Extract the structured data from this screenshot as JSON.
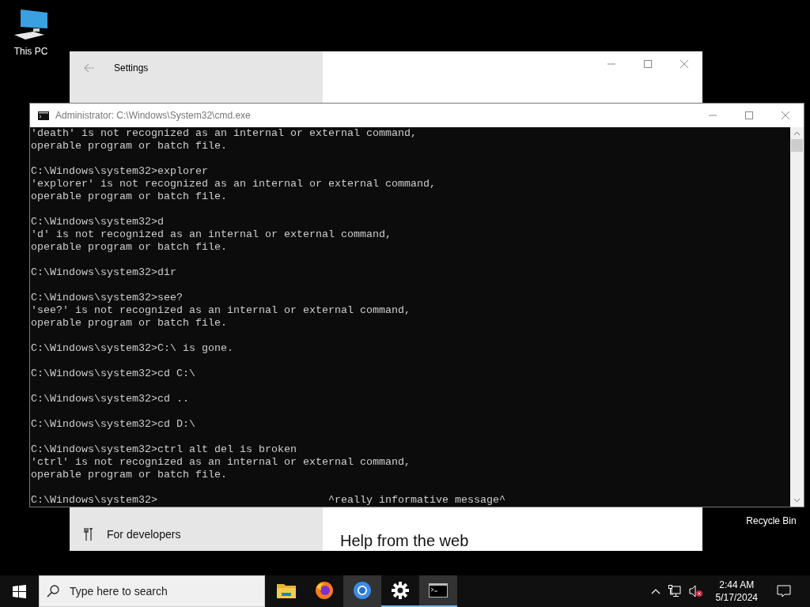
{
  "desktop_icons": [
    {
      "kind": "computer",
      "label": "This PC"
    },
    {
      "kind": "recycle",
      "label": "Recycle Bin"
    }
  ],
  "settings_window": {
    "title": "Settings",
    "sidebar_item": "For developers",
    "heading": "Help from the web"
  },
  "cmd_window": {
    "title": "Administrator: C:\\Windows\\System32\\cmd.exe",
    "blocks": [
      {
        "lines": [
          "'death' is not recognized as an internal or external command,",
          "operable program or batch file."
        ]
      },
      {
        "lines": [
          "C:\\Windows\\system32>explorer",
          "'explorer' is not recognized as an internal or external command,",
          "operable program or batch file."
        ]
      },
      {
        "lines": [
          "C:\\Windows\\system32>d",
          "'d' is not recognized as an internal or external command,",
          "operable program or batch file."
        ]
      },
      {
        "lines": [
          "C:\\Windows\\system32>dir"
        ]
      },
      {
        "lines": [
          "C:\\Windows\\system32>see?",
          "'see?' is not recognized as an internal or external command,",
          "operable program or batch file."
        ]
      },
      {
        "lines": [
          "C:\\Windows\\system32>C:\\ is gone."
        ]
      },
      {
        "lines": [
          "C:\\Windows\\system32>cd C:\\"
        ]
      },
      {
        "lines": [
          "C:\\Windows\\system32>cd .."
        ]
      },
      {
        "lines": [
          "C:\\Windows\\system32>cd D:\\"
        ]
      },
      {
        "lines": [
          "C:\\Windows\\system32>ctrl alt del is broken",
          "'ctrl' is not recognized as an internal or external command,",
          "operable program or batch file."
        ]
      }
    ],
    "prompt": "C:\\Windows\\system32>",
    "note": "^really informative message^"
  },
  "taskbar": {
    "search": {
      "placeholder": "Type here to search"
    },
    "apps": [
      {
        "kind": "folder",
        "running": false,
        "highlighted": false
      },
      {
        "kind": "firefox",
        "running": false,
        "highlighted": false
      },
      {
        "kind": "chrome",
        "running": false,
        "highlighted": true
      },
      {
        "kind": "settings",
        "running": true,
        "highlighted": false
      },
      {
        "kind": "terminal",
        "running": true,
        "highlighted": true
      }
    ],
    "time": "2:44 AM",
    "date": "5/17/2024"
  }
}
